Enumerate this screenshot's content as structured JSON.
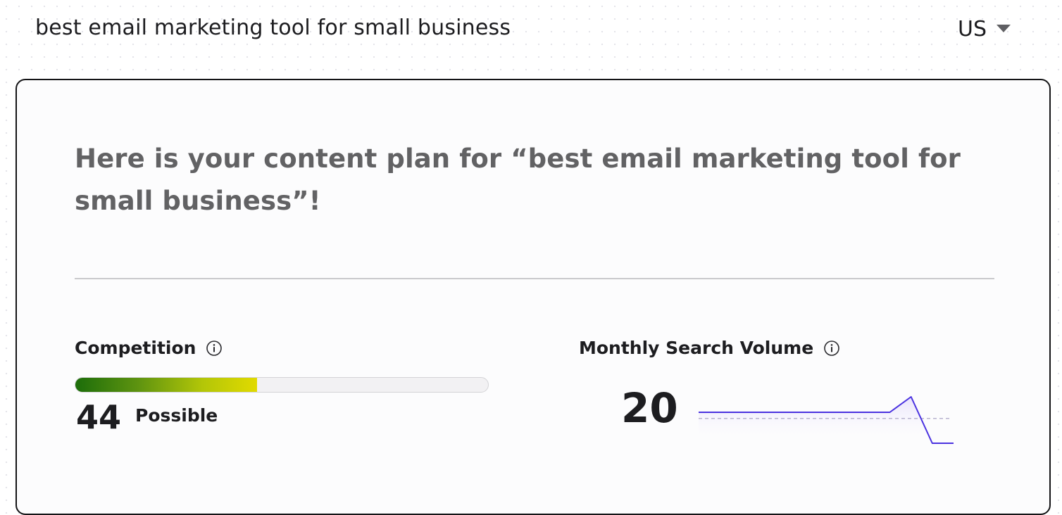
{
  "search": {
    "keyword": "best email marketing tool for small business",
    "country": "US",
    "country_icon": "chevron-down-icon"
  },
  "plan": {
    "headline": "Here is your content plan for “best email marketing tool for small business”!"
  },
  "competition": {
    "label": "Competition",
    "info_icon": "info-icon",
    "score": "44",
    "level": "Possible",
    "fill_percent": 44,
    "gradient_colors": [
      "#1c6d0a",
      "#e1da00"
    ]
  },
  "search_volume": {
    "label": "Monthly Search Volume",
    "info_icon": "info-icon",
    "value": "20"
  },
  "chart_data": {
    "type": "line",
    "title": "",
    "xlabel": "",
    "ylabel": "",
    "series": [
      {
        "values": [
          20,
          20,
          20,
          20,
          20,
          20,
          20,
          20,
          20,
          20,
          30,
          0,
          0
        ]
      }
    ],
    "average_line": 16,
    "ylim": [
      0,
      30
    ],
    "grid": false,
    "line_color": "#4a32e0",
    "fill_color": "#ece8fb"
  },
  "colors": {
    "card_border": "#141416",
    "headline": "#626264",
    "accent": "#4a32e0"
  }
}
